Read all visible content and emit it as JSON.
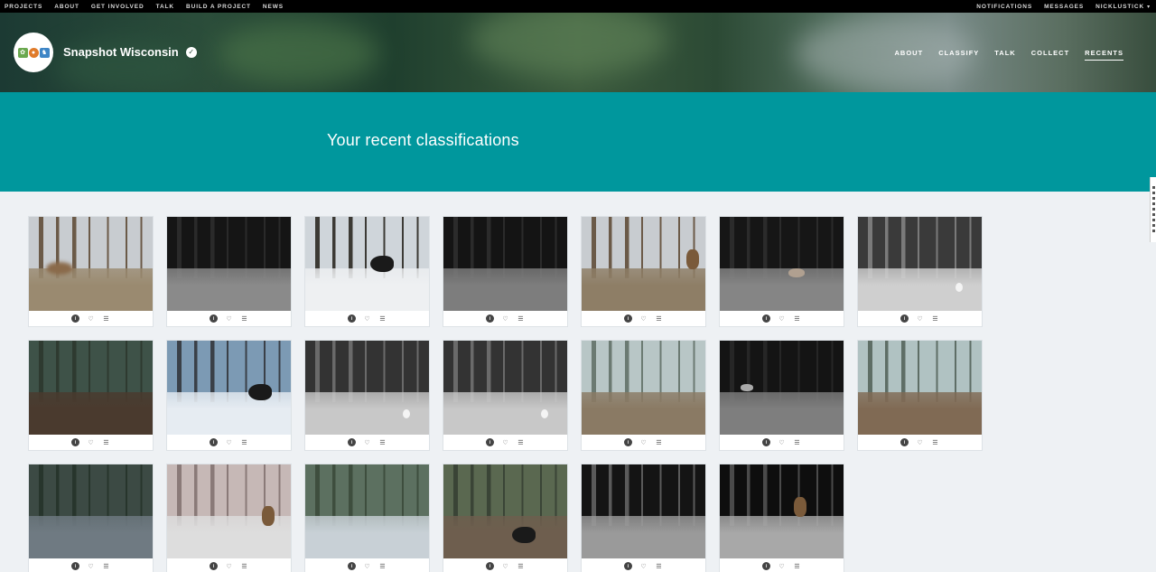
{
  "topnav": {
    "left": [
      "PROJECTS",
      "ABOUT",
      "GET INVOLVED",
      "TALK",
      "BUILD A PROJECT",
      "NEWS"
    ],
    "right": [
      "NOTIFICATIONS",
      "MESSAGES"
    ],
    "user": "NICKLUSTICK"
  },
  "project": {
    "name": "Snapshot Wisconsin",
    "nav": [
      "ABOUT",
      "CLASSIFY",
      "TALK",
      "COLLECT",
      "RECENTS"
    ],
    "active_nav": "RECENTS"
  },
  "page": {
    "heading": "Your recent classifications"
  },
  "thumbs": [
    {
      "tree": "#6b5a48",
      "ground": "#9a8a70",
      "sky": "#c8ccd0",
      "animal": "deer-blur",
      "ax": 0.25,
      "ay": 0.55
    },
    {
      "tree": "#2a2a2a",
      "ground": "#8a8a8a",
      "sky": "#151515",
      "animal": "none"
    },
    {
      "tree": "#3c3a35",
      "ground": "#eef0f2",
      "sky": "#cfd5da",
      "animal": "turkey",
      "ax": 0.62,
      "ay": 0.5
    },
    {
      "tree": "#2b2b2b",
      "ground": "#7d7d7d",
      "sky": "#141414",
      "animal": "none"
    },
    {
      "tree": "#6b5a48",
      "ground": "#8e7e66",
      "sky": "#c8ccd0",
      "animal": "deer",
      "ax": 0.9,
      "ay": 0.45
    },
    {
      "tree": "#2b2b2b",
      "ground": "#858585",
      "sky": "#161616",
      "animal": "coyote",
      "ax": 0.62,
      "ay": 0.6
    },
    {
      "tree": "#7a7a7a",
      "ground": "#cfcfcf",
      "sky": "#3a3a3a",
      "animal": "hare",
      "ax": 0.82,
      "ay": 0.75
    },
    {
      "tree": "#2e3a30",
      "ground": "#4a3a2e",
      "sky": "#3e5248",
      "animal": "none"
    },
    {
      "tree": "#3a4048",
      "ground": "#e6ecf2",
      "sky": "#7c9ab4",
      "animal": "turkey",
      "ax": 0.75,
      "ay": 0.55
    },
    {
      "tree": "#6a6a6a",
      "ground": "#c8c8c8",
      "sky": "#333333",
      "animal": "hare",
      "ax": 0.82,
      "ay": 0.78
    },
    {
      "tree": "#6a6a6a",
      "ground": "#c8c8c8",
      "sky": "#333333",
      "animal": "hare",
      "ax": 0.82,
      "ay": 0.78
    },
    {
      "tree": "#6b7a72",
      "ground": "#8a7a64",
      "sky": "#b8c6c6",
      "animal": "none"
    },
    {
      "tree": "#262626",
      "ground": "#7e7e7e",
      "sky": "#141414",
      "animal": "fox",
      "ax": 0.22,
      "ay": 0.5
    },
    {
      "tree": "#5e6e66",
      "ground": "#806a54",
      "sky": "#b0c2c2",
      "animal": "none"
    },
    {
      "tree": "#27352c",
      "ground": "#6f7a82",
      "sky": "#3c4a44",
      "animal": "none"
    },
    {
      "tree": "#8a7a78",
      "ground": "#dddddd",
      "sky": "#c6b8b6",
      "animal": "deer",
      "ax": 0.82,
      "ay": 0.55
    },
    {
      "tree": "#3e4e3e",
      "ground": "#c8d0d6",
      "sky": "#5c7060",
      "animal": "none"
    },
    {
      "tree": "#3a4436",
      "ground": "#6e5e4e",
      "sky": "#5a6850",
      "animal": "turkey",
      "ax": 0.65,
      "ay": 0.75
    },
    {
      "tree": "#5a5a5a",
      "ground": "#9a9a9a",
      "sky": "#141414",
      "animal": "none"
    },
    {
      "tree": "#4a4a4a",
      "ground": "#a8a8a8",
      "sky": "#0e0e0e",
      "animal": "deer",
      "ax": 0.65,
      "ay": 0.45
    }
  ],
  "icons": [
    "info-icon",
    "heart-icon",
    "list-icon"
  ]
}
